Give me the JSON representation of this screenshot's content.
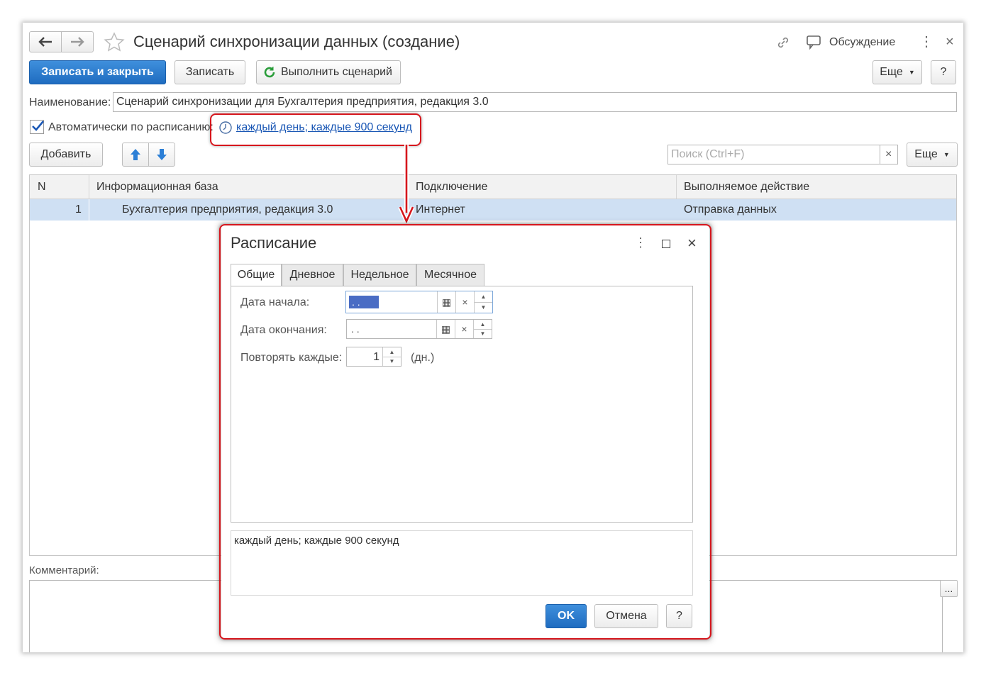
{
  "window": {
    "title": "Сценарий синхронизации данных (создание)",
    "discussion_label": "Обсуждение"
  },
  "toolbar": {
    "save_close": "Записать и закрыть",
    "save": "Записать",
    "run": "Выполнить сценарий",
    "more": "Еще",
    "help": "?"
  },
  "form": {
    "name_label": "Наименование:",
    "name_value": "Сценарий синхронизации для Бухгалтерия предприятия, редакция 3.0",
    "auto_label": "Автоматически по расписанию:",
    "schedule_link": "каждый день; каждые 900 секунд"
  },
  "table_toolbar": {
    "add": "Добавить",
    "search_placeholder": "Поиск (Ctrl+F)",
    "more": "Еще",
    "clear": "×"
  },
  "table": {
    "columns": [
      "N",
      "Информационная база",
      "Подключение",
      "Выполняемое действие"
    ],
    "rows": [
      {
        "n": "1",
        "base": "Бухгалтерия предприятия, редакция 3.0",
        "connection": "Интернет",
        "action": "Отправка данных"
      }
    ]
  },
  "comment": {
    "label": "Комментарий:",
    "button": "..."
  },
  "dialog": {
    "title": "Расписание",
    "tabs": [
      "Общие",
      "Дневное",
      "Недельное",
      "Месячное"
    ],
    "start_label": "Дата начала:",
    "start_value": " .  .",
    "end_label": "Дата окончания:",
    "end_value": " .  .",
    "repeat_label": "Повторять каждые:",
    "repeat_value": "1",
    "repeat_unit": "(дн.)",
    "summary": "каждый день; каждые 900 секунд",
    "ok": "OK",
    "cancel": "Отмена",
    "help": "?"
  },
  "colors": {
    "accent": "#1f6cc0",
    "selection": "#cfe0f3",
    "highlight": "#d6161d",
    "link": "#1a57b5"
  }
}
